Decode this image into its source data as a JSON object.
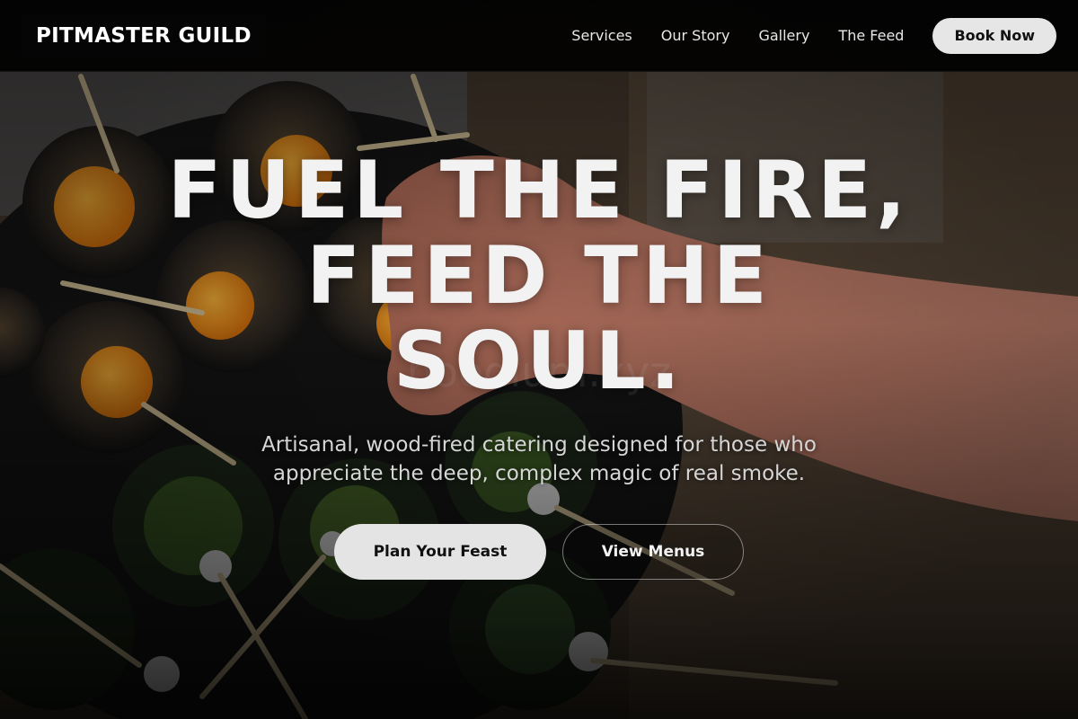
{
  "navbar": {
    "logo_text": "PITMASTER GUILD",
    "links": [
      {
        "label": "Services"
      },
      {
        "label": "Our Story"
      },
      {
        "label": "Gallery"
      },
      {
        "label": "The Feed"
      }
    ],
    "cta_label": "Book Now"
  },
  "hero": {
    "title_line1": "FUEL THE FIRE,",
    "title_line2": "FEED THE",
    "title_line3": "SOUL.",
    "subtitle": "Artisanal, wood-fired catering designed for those who appreciate the deep, complex magic of real smoke.",
    "primary_cta": "Plan Your Feast",
    "secondary_cta": "View Menus",
    "background_image": "photo of catering cups with skewers and a reaching hand"
  },
  "colors": {
    "navbar_bg": "#000000",
    "button_light": "#e6e6e6",
    "text_primary": "#f2f2f2",
    "text_secondary": "#d6d6d6"
  }
}
